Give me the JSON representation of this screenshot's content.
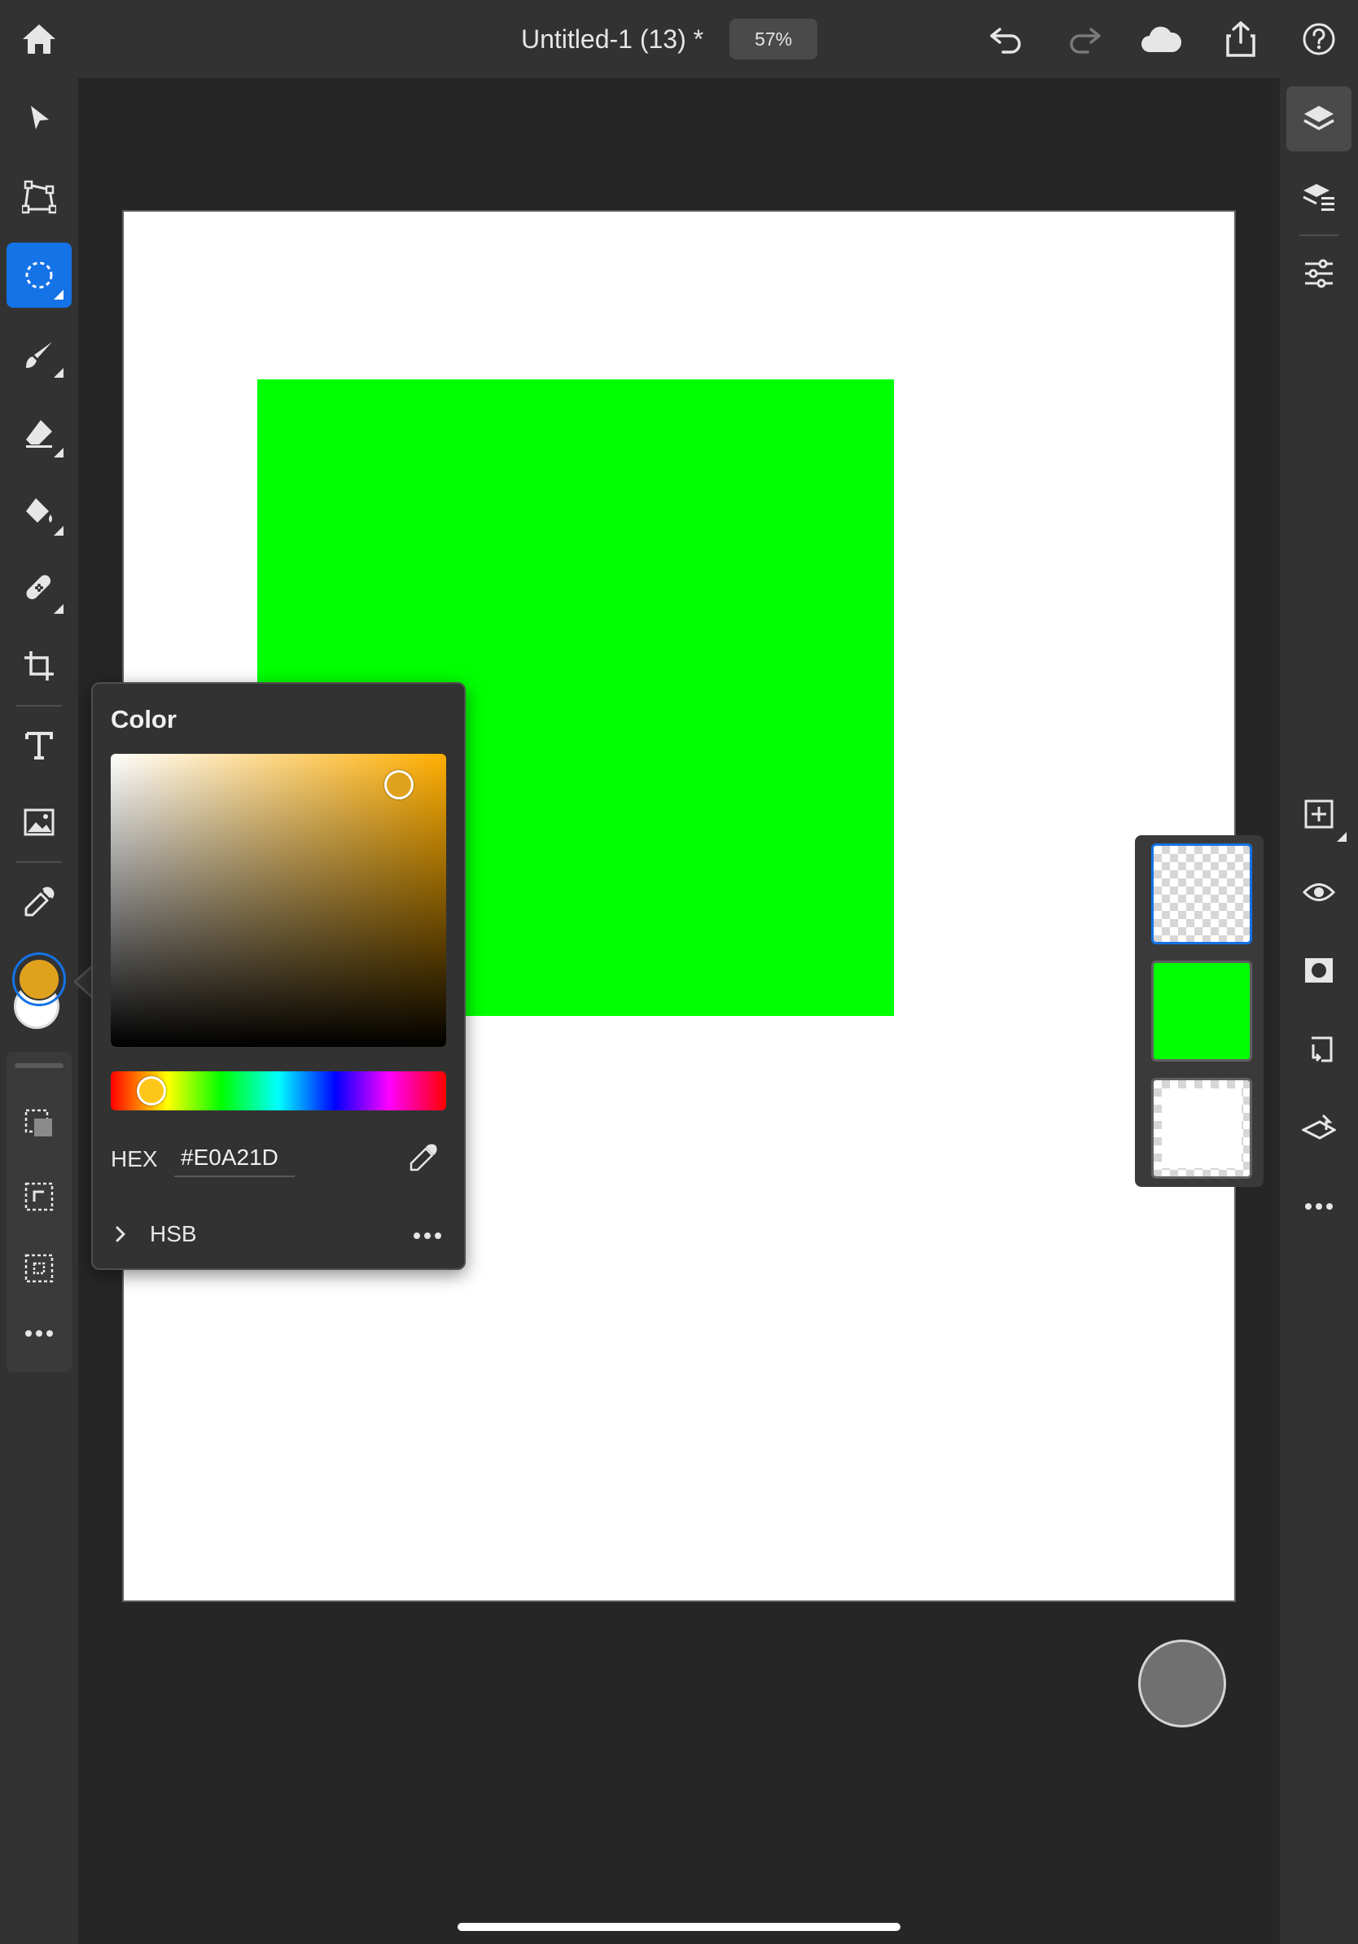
{
  "header": {
    "document_title": "Untitled-1 (13) *",
    "zoom_level": "57%"
  },
  "colors": {
    "accent": "#1473e6",
    "foreground_swatch": "#E0A21D",
    "background_swatch": "#FFFFFF",
    "canvas_shape": "#00FF00"
  },
  "toolbar_icons": [
    "home-icon",
    "move-icon",
    "transform-icon",
    "selection-icon",
    "brush-icon",
    "eraser-icon",
    "fill-icon",
    "healing-icon",
    "crop-icon",
    "type-icon",
    "place-image-icon",
    "eyedropper-icon"
  ],
  "color_panel": {
    "title": "Color",
    "hex_label": "HEX",
    "hex_value": "#E0A21D",
    "mode_label": "HSB"
  },
  "layers": [
    {
      "name": "transparent-layer",
      "selected": true
    },
    {
      "name": "green-layer",
      "selected": false
    },
    {
      "name": "white-background-layer",
      "selected": false
    }
  ]
}
